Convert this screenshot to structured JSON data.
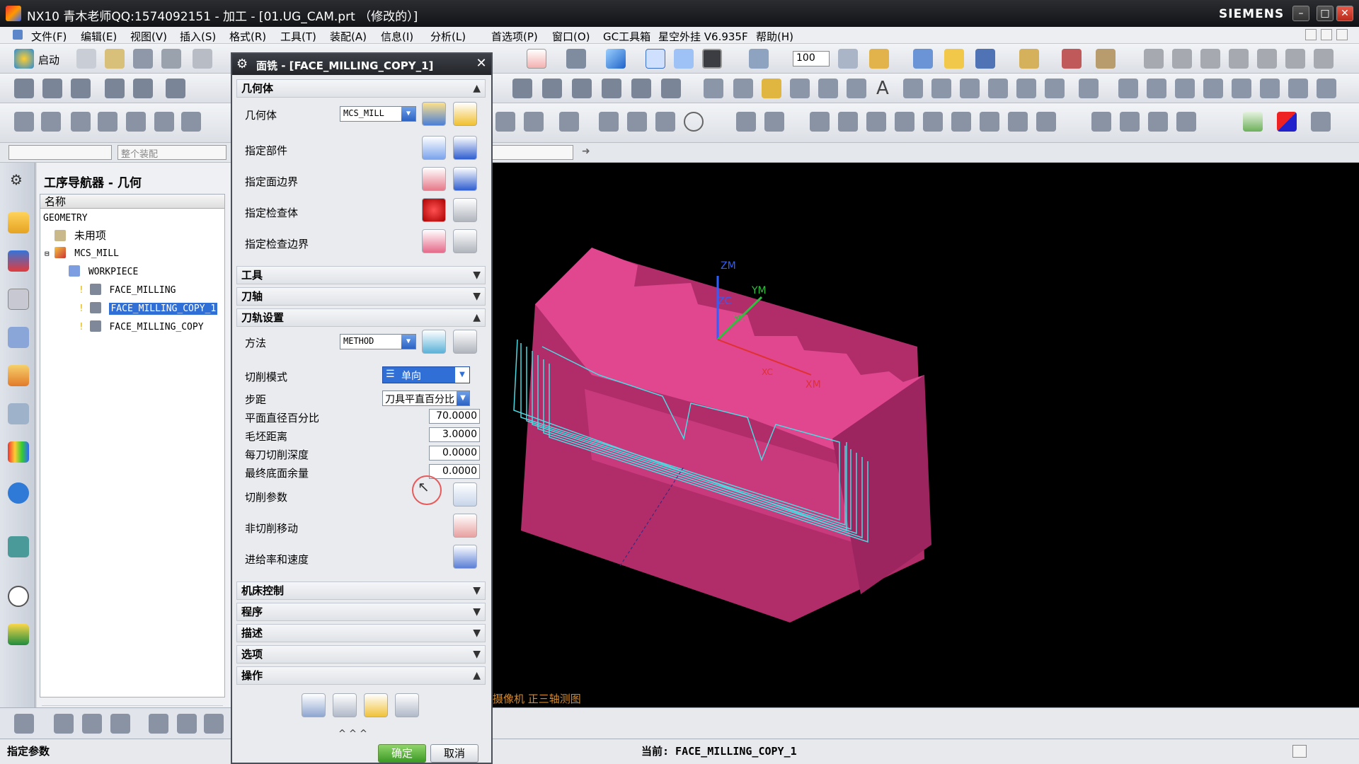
{
  "window": {
    "title": "NX10 青木老师QQ:1574092151 - 加工 - [01.UG_CAM.prt （修改的）]",
    "brand": "SIEMENS"
  },
  "menubar": {
    "items": [
      "文件(F)",
      "编辑(E)",
      "视图(V)",
      "插入(S)",
      "格式(R)",
      "工具(T)",
      "装配(A)",
      "信息(I)",
      "分析(L)",
      "首选项(P)",
      "窗口(O)",
      "GC工具箱",
      "星空外挂 V6.935F",
      "帮助(H)"
    ]
  },
  "toolbar": {
    "start_label": "启动",
    "zoom_value": "100"
  },
  "selection_bar": {
    "filter_placeholder": "",
    "scope_value": "整个装配"
  },
  "navigator": {
    "title": "工序导航器 - 几何",
    "column_name": "名称",
    "rows": [
      {
        "label": "GEOMETRY"
      },
      {
        "label": "未用项"
      },
      {
        "label": "MCS_MILL"
      },
      {
        "label": "WORKPIECE"
      },
      {
        "label": "FACE_MILLING"
      },
      {
        "label": "FACE_MILLING_COPY_1"
      },
      {
        "label": "FACE_MILLING_COPY"
      }
    ]
  },
  "dialog": {
    "title": "面铣 - [FACE_MILLING_COPY_1]",
    "sections": {
      "geometry": "几何体",
      "tool": "工具",
      "axis": "刀轴",
      "path_settings": "刀轨设置",
      "machine_control": "机床控制",
      "program": "程序",
      "description": "描述",
      "options": "选项",
      "actions": "操作"
    },
    "geometry": {
      "geometry_label": "几何体",
      "geometry_value": "MCS_MILL",
      "part_label": "指定部件",
      "face_boundary_label": "指定面边界",
      "check_body_label": "指定检查体",
      "check_boundary_label": "指定检查边界"
    },
    "path": {
      "method_label": "方法",
      "method_value": "METHOD",
      "cut_pattern_label": "切削模式",
      "cut_pattern_value": "单向",
      "stepover_label": "步距",
      "stepover_value": "刀具平直百分比",
      "flat_diameter_label": "平面直径百分比",
      "flat_diameter_value": "70.0000",
      "blank_distance_label": "毛坯距离",
      "blank_distance_value": "3.0000",
      "depth_per_cut_label": "每刀切削深度",
      "depth_per_cut_value": "0.0000",
      "final_floor_label": "最终底面余量",
      "final_floor_value": "0.0000",
      "cut_params_label": "切削参数",
      "non_cut_label": "非切削移动",
      "feeds_label": "进给率和速度"
    },
    "ok_label": "确定",
    "cancel_label": "取消"
  },
  "graphics": {
    "view_label": "摄像机 正三轴测图",
    "axes": {
      "zm": "ZM",
      "ym": "YM",
      "zc": "ZC",
      "yc": "YC",
      "xc": "XC",
      "xm": "XM"
    }
  },
  "status": {
    "left": "指定参数",
    "current": "当前: FACE_MILLING_COPY_1"
  },
  "colors": {
    "part": "#d93f8a",
    "toolpath": "#4fd8e0",
    "selection": "#2f6fd6",
    "graphics_bg": "#000000"
  }
}
